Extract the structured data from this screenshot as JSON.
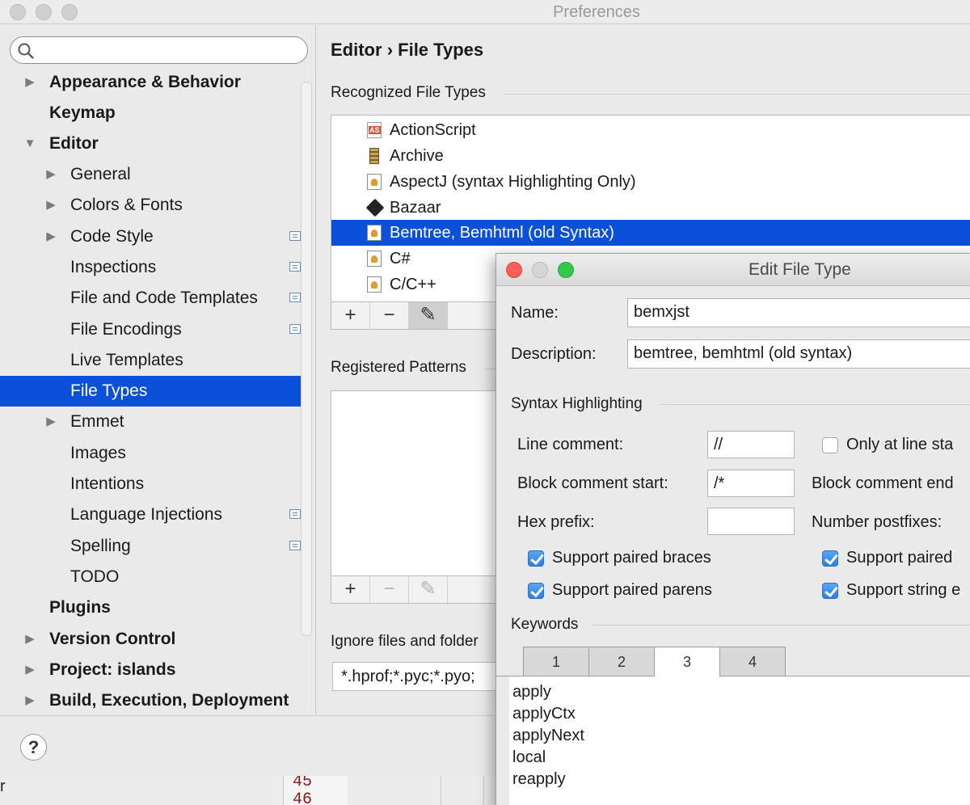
{
  "window": {
    "title": "Preferences"
  },
  "sidebar": {
    "search": {
      "value": "",
      "placeholder": ""
    },
    "items": [
      {
        "label": "Appearance & Behavior"
      },
      {
        "label": "Keymap"
      },
      {
        "label": "Editor"
      },
      {
        "label": "General"
      },
      {
        "label": "Colors & Fonts"
      },
      {
        "label": "Code Style"
      },
      {
        "label": "Inspections"
      },
      {
        "label": "File and Code Templates"
      },
      {
        "label": "File Encodings"
      },
      {
        "label": "Live Templates"
      },
      {
        "label": "File Types"
      },
      {
        "label": "Emmet"
      },
      {
        "label": "Images"
      },
      {
        "label": "Intentions"
      },
      {
        "label": "Language Injections"
      },
      {
        "label": "Spelling"
      },
      {
        "label": "TODO"
      },
      {
        "label": "Plugins"
      },
      {
        "label": "Version Control"
      },
      {
        "label": "Project: islands"
      },
      {
        "label": "Build, Execution, Deployment"
      }
    ]
  },
  "help": {
    "label": "?"
  },
  "content": {
    "breadcrumb_parent": "Editor",
    "breadcrumb_separator": "›",
    "breadcrumb_current": "File Types",
    "recognized_title": "Recognized File Types",
    "file_types": [
      {
        "label": "ActionScript",
        "icon": "actionscript-file-icon"
      },
      {
        "label": "Archive",
        "icon": "archive-icon"
      },
      {
        "label": "AspectJ (syntax Highlighting Only)",
        "icon": "custom-file-icon"
      },
      {
        "label": "Bazaar",
        "icon": "bazaar-icon"
      },
      {
        "label": "Bemtree, Bemhtml (old Syntax)",
        "icon": "custom-file-icon"
      },
      {
        "label": "C#",
        "icon": "custom-file-icon"
      },
      {
        "label": "C/C++",
        "icon": "custom-file-icon"
      }
    ],
    "add_label": "+",
    "remove_label": "−",
    "edit_label": "✎",
    "patterns_title": "Registered Patterns",
    "ignore_label": "Ignore files and folder",
    "ignore_value": "*.hprof;*.pyc;*.pyo;"
  },
  "dialog": {
    "title": "Edit File Type",
    "name_label": "Name:",
    "name_value": "bemxjst",
    "description_label": "Description:",
    "description_value": "bemtree, bemhtml (old syntax)",
    "syntax_title": "Syntax Highlighting",
    "line_comment_label": "Line comment:",
    "line_comment_value": "//",
    "only_at_line_start_label": "Only at line sta",
    "block_start_label": "Block comment start:",
    "block_start_value": "/*",
    "block_end_label": "Block comment end",
    "hex_prefix_label": "Hex prefix:",
    "hex_prefix_value": "",
    "number_postfixes_label": "Number postfixes:",
    "paired_braces_label": "Support paired braces",
    "paired_parens_label": "Support paired parens",
    "paired_brackets_label": "Support paired",
    "string_escapes_label": "Support string e",
    "keywords_title": "Keywords",
    "tabs": [
      "1",
      "2",
      "3",
      "4"
    ],
    "active_tab": "3",
    "keywords": [
      "apply",
      "applyCtx",
      "applyNext",
      "local",
      "reapply"
    ]
  },
  "background": {
    "line_numbers": [
      "45",
      "46"
    ],
    "edge_text": "r"
  },
  "colors": {
    "selection": "#0a50d8",
    "checkbox": "#2d7fe6"
  }
}
